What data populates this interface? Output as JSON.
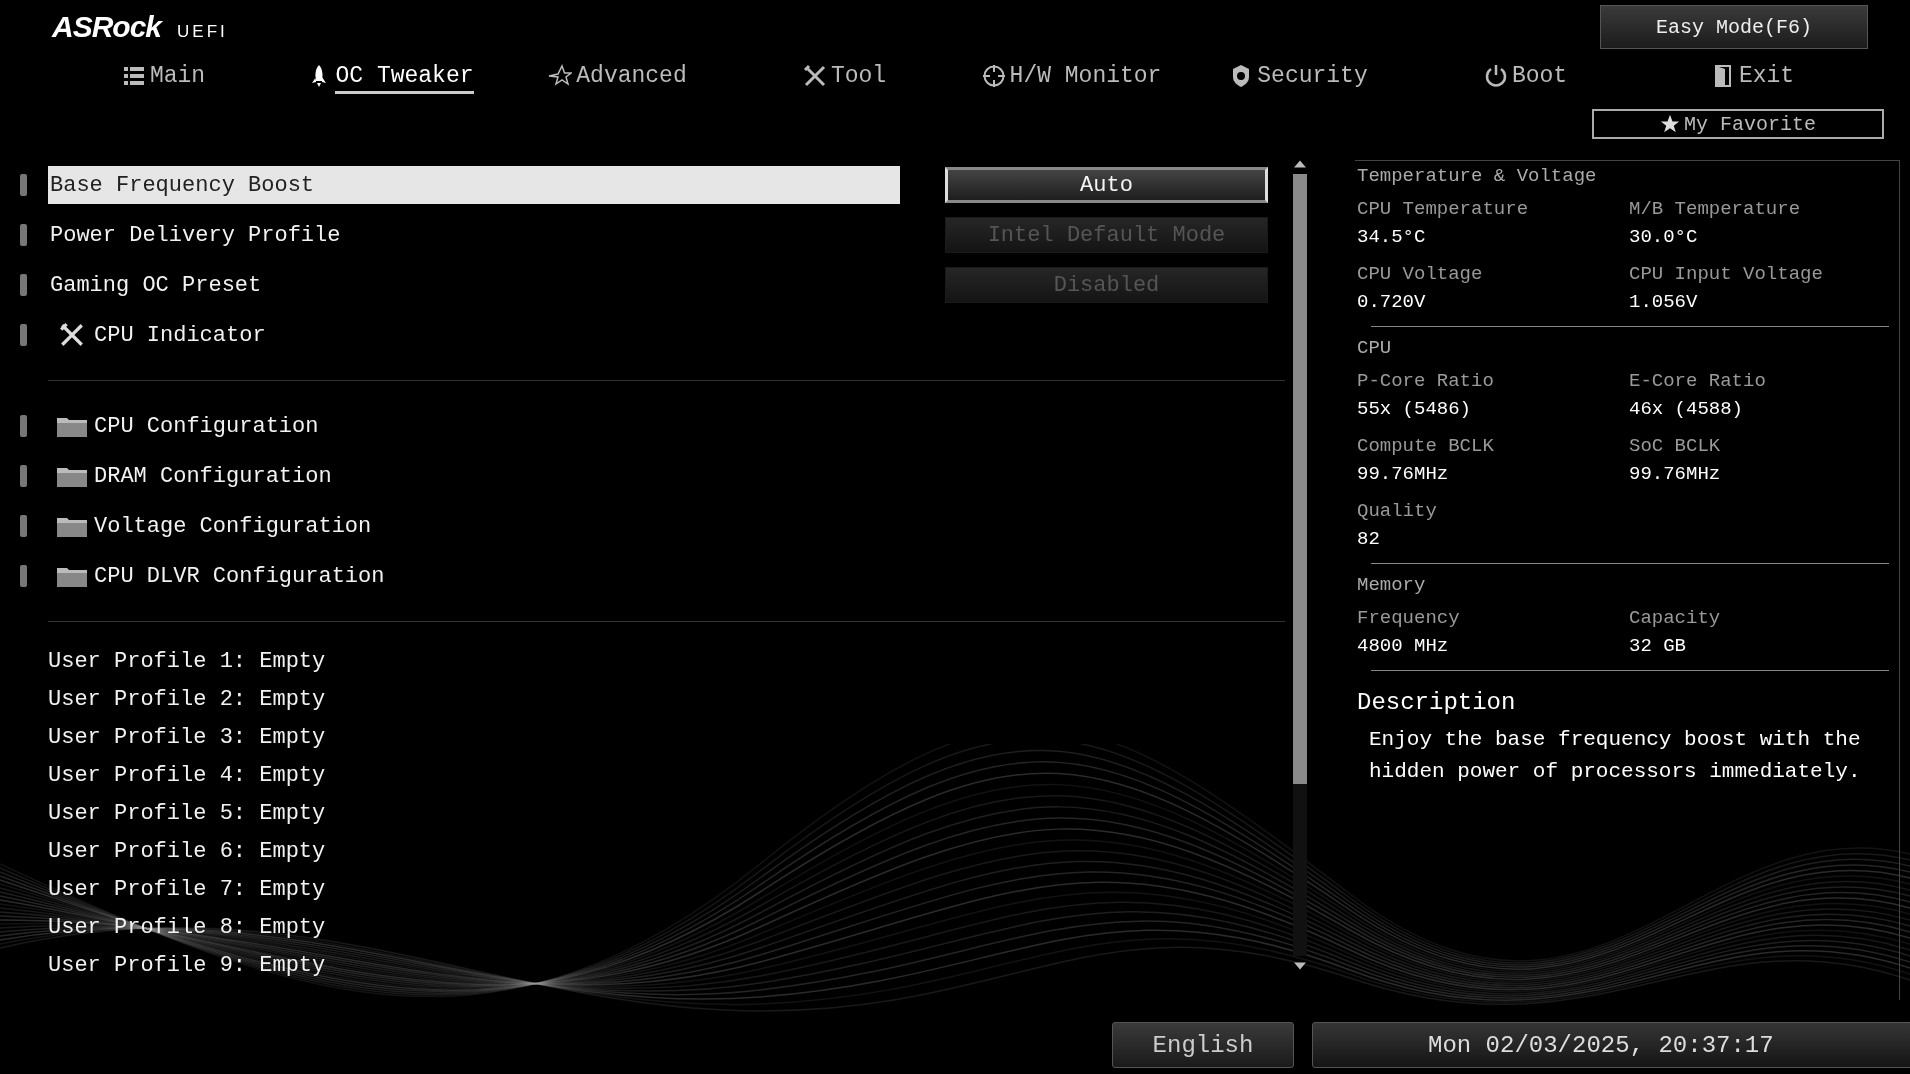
{
  "header": {
    "brand": "ASRock",
    "product": "UEFI",
    "easy_mode": "Easy Mode(F6)",
    "favorite": "My Favorite"
  },
  "tabs": [
    {
      "label": "Main",
      "selected": false
    },
    {
      "label": "OC Tweaker",
      "selected": true
    },
    {
      "label": "Advanced",
      "selected": false
    },
    {
      "label": "Tool",
      "selected": false
    },
    {
      "label": "H/W Monitor",
      "selected": false
    },
    {
      "label": "Security",
      "selected": false
    },
    {
      "label": "Boot",
      "selected": false
    },
    {
      "label": "Exit",
      "selected": false
    }
  ],
  "settings": [
    {
      "kind": "setting",
      "label": "Base Frequency Boost",
      "selected": true,
      "value": "Auto",
      "disabled": false
    },
    {
      "kind": "setting",
      "label": "Power Delivery Profile",
      "selected": false,
      "value": "Intel Default Mode",
      "disabled": true
    },
    {
      "kind": "setting",
      "label": "Gaming OC Preset",
      "selected": false,
      "value": "Disabled",
      "disabled": true
    },
    {
      "kind": "tool",
      "label": "CPU Indicator",
      "selected": false
    }
  ],
  "submenus": [
    {
      "label": "CPU Configuration"
    },
    {
      "label": "DRAM Configuration"
    },
    {
      "label": "Voltage Configuration"
    },
    {
      "label": "CPU DLVR Configuration"
    }
  ],
  "profiles": [
    "User Profile 1: Empty",
    "User Profile 2: Empty",
    "User Profile 3: Empty",
    "User Profile 4: Empty",
    "User Profile 5: Empty",
    "User Profile 6: Empty",
    "User Profile 7: Empty",
    "User Profile 8: Empty",
    "User Profile 9: Empty"
  ],
  "info_panel": [
    {
      "title": "Temperature & Voltage",
      "fields": [
        {
          "label": "CPU Temperature",
          "value": "34.5°C"
        },
        {
          "label": "M/B Temperature",
          "value": "30.0°C"
        },
        {
          "label": "CPU Voltage",
          "value": "0.720V"
        },
        {
          "label": "CPU Input Voltage",
          "value": "1.056V"
        }
      ]
    },
    {
      "title": "CPU",
      "fields": [
        {
          "label": "P-Core Ratio",
          "value": "55x (5486)"
        },
        {
          "label": "E-Core Ratio",
          "value": "46x (4588)"
        },
        {
          "label": "Compute BCLK",
          "value": "99.76MHz"
        },
        {
          "label": "SoC BCLK",
          "value": "99.76MHz"
        },
        {
          "label": "Quality",
          "value": "82"
        }
      ]
    },
    {
      "title": "Memory",
      "fields": [
        {
          "label": "Frequency",
          "value": "4800 MHz"
        },
        {
          "label": "Capacity",
          "value": "32 GB"
        }
      ]
    }
  ],
  "description": {
    "title": "Description",
    "text": "Enjoy the base frequency boost with the hidden power of processors immediately."
  },
  "status_bar": {
    "language": "English",
    "datetime": "Mon 02/03/2025, 20:37:17"
  }
}
